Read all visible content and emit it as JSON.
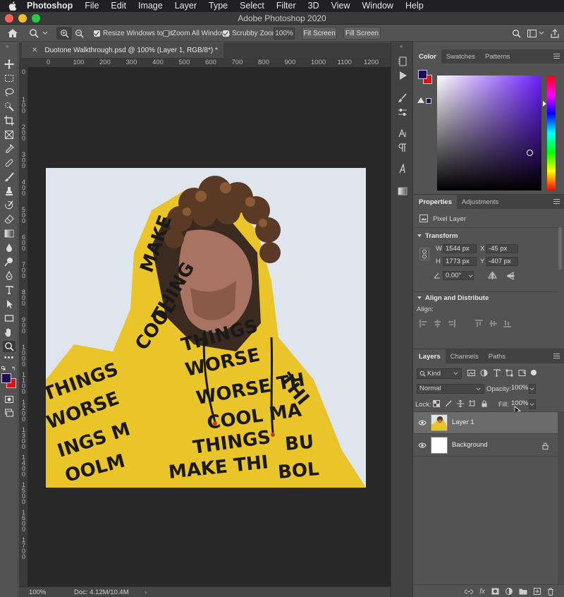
{
  "menubar": {
    "app": "Photoshop",
    "items": [
      "File",
      "Edit",
      "Image",
      "Layer",
      "Type",
      "Select",
      "Filter",
      "3D",
      "View",
      "Window",
      "Help"
    ]
  },
  "window": {
    "title": "Adobe Photoshop 2020"
  },
  "options": {
    "resize_windows": "Resize Windows to Fit",
    "zoom_all": "Zoom All Windows",
    "scrubby_zoom": "Scrubby Zoom",
    "zoom_value": "100%",
    "fit_screen": "Fit Screen",
    "fill_screen": "Fill Screen"
  },
  "document": {
    "tab_title": "Duotone Walkthrough.psd @ 100% (Layer 1, RGB/8*) *",
    "ruler_h": [
      "0",
      "100",
      "200",
      "300",
      "400",
      "500",
      "600",
      "700",
      "800",
      "900",
      "1000",
      "1100",
      "1200"
    ],
    "ruler_v": [
      "0",
      "1 0 0",
      "2 0 0",
      "3 0 0",
      "4 0 0",
      "5 0 0",
      "6 0 0",
      "7 0 0",
      "8 0 0",
      "9 0 0",
      "1 0 0 0",
      "1 1 0 0",
      "1 2 0 0",
      "1 3 0 0",
      "1 4 0 0",
      "1 5 0 0",
      "1 6 0 0",
      "1 7 0 0"
    ],
    "status_zoom": "100%",
    "status_doc": "Doc: 4.12M/10.4M"
  },
  "colors": {
    "foreground": "#1e0e5a",
    "background": "#e01010",
    "accent_yellow": "#e8c227"
  },
  "color_panel": {
    "tabs": [
      "Color",
      "Swatches",
      "Patterns"
    ]
  },
  "properties_panel": {
    "tabs": [
      "Properties",
      "Adjustments"
    ],
    "layer_type": "Pixel Layer",
    "transform_title": "Transform",
    "w_label": "W",
    "w_value": "1544 px",
    "x_label": "X",
    "x_value": "-45 px",
    "h_label": "H",
    "h_value": "1773 px",
    "y_label": "Y",
    "y_value": "-407 px",
    "angle_value": "0.00°",
    "align_title": "Align and Distribute",
    "align_label": "Align:"
  },
  "layers_panel": {
    "tabs": [
      "Layers",
      "Channels",
      "Paths"
    ],
    "filter_kind": "Kind",
    "blend_mode": "Normal",
    "opacity_label": "Opacity:",
    "opacity_value": "100%",
    "lock_label": "Lock:",
    "fill_label": "Fill:",
    "fill_value": "100%",
    "layers": [
      {
        "name": "Layer 1",
        "selected": true
      },
      {
        "name": "Background",
        "selected": false
      }
    ]
  }
}
